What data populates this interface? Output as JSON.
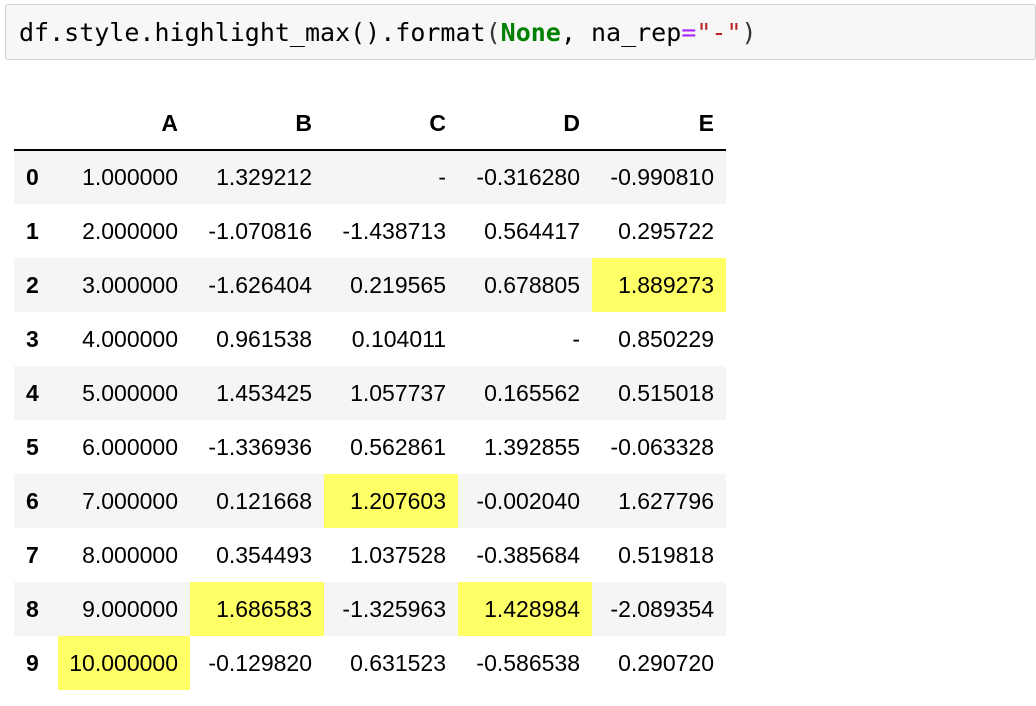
{
  "code_cell": {
    "prefix": "df.style.highlight_max().format",
    "open_paren": "(",
    "keyword": "None",
    "mid": ", na_rep",
    "equals": "=",
    "string": "\"-\"",
    "close_paren": ")"
  },
  "table": {
    "columns": [
      "A",
      "B",
      "C",
      "D",
      "E"
    ],
    "rows": [
      {
        "index": "0",
        "cells": [
          "1.000000",
          "1.329212",
          "-",
          "-0.316280",
          "-0.990810"
        ],
        "highlight": []
      },
      {
        "index": "1",
        "cells": [
          "2.000000",
          "-1.070816",
          "-1.438713",
          "0.564417",
          "0.295722"
        ],
        "highlight": []
      },
      {
        "index": "2",
        "cells": [
          "3.000000",
          "-1.626404",
          "0.219565",
          "0.678805",
          "1.889273"
        ],
        "highlight": [
          4
        ]
      },
      {
        "index": "3",
        "cells": [
          "4.000000",
          "0.961538",
          "0.104011",
          "-",
          "0.850229"
        ],
        "highlight": []
      },
      {
        "index": "4",
        "cells": [
          "5.000000",
          "1.453425",
          "1.057737",
          "0.165562",
          "0.515018"
        ],
        "highlight": []
      },
      {
        "index": "5",
        "cells": [
          "6.000000",
          "-1.336936",
          "0.562861",
          "1.392855",
          "-0.063328"
        ],
        "highlight": []
      },
      {
        "index": "6",
        "cells": [
          "7.000000",
          "0.121668",
          "1.207603",
          "-0.002040",
          "1.627796"
        ],
        "highlight": [
          2
        ]
      },
      {
        "index": "7",
        "cells": [
          "8.000000",
          "0.354493",
          "1.037528",
          "-0.385684",
          "0.519818"
        ],
        "highlight": []
      },
      {
        "index": "8",
        "cells": [
          "9.000000",
          "1.686583",
          "-1.325963",
          "1.428984",
          "-2.089354"
        ],
        "highlight": [
          1,
          3
        ]
      },
      {
        "index": "9",
        "cells": [
          "10.000000",
          "-0.129820",
          "0.631523",
          "-0.586538",
          "0.290720"
        ],
        "highlight": [
          0
        ]
      }
    ]
  },
  "colors": {
    "highlight": "#ffff66",
    "row_alt": "#f5f5f5",
    "cell_bg": "#f7f7f7",
    "keyword": "#008000",
    "operator": "#aa22ff",
    "string": "#ba2121"
  }
}
